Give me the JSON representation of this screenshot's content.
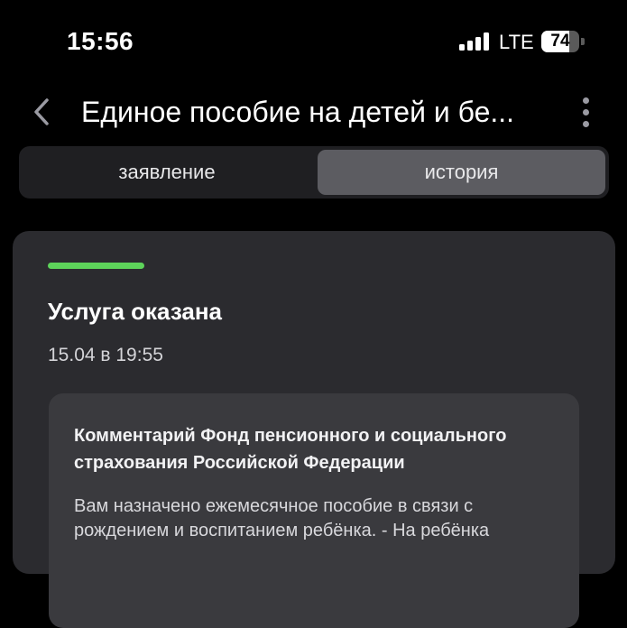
{
  "status_bar": {
    "time": "15:56",
    "network": "LTE",
    "battery": "74"
  },
  "header": {
    "title": "Единое пособие на детей и бе...",
    "back_icon": "chevron-left-icon",
    "menu_icon": "more-vertical-icon"
  },
  "tabs": [
    {
      "label": "заявление",
      "selected": false
    },
    {
      "label": "история",
      "selected": true
    }
  ],
  "card": {
    "status_color": "#5dd35a",
    "status": "Услуга оказана",
    "date": "15.04 в 19:55",
    "comment": {
      "title": "Комментарий Фонд пенсионного и социального страхования Российской Федерации",
      "text": "Вам назначено ежемесячное пособие в связи с рождением и воспитанием ребёнка. - На ребёнка"
    }
  },
  "colors": {
    "background": "#000000",
    "card": "#2b2b2f",
    "comment_bg": "#3a3a3e",
    "selected_tab": "#5c5c61"
  }
}
